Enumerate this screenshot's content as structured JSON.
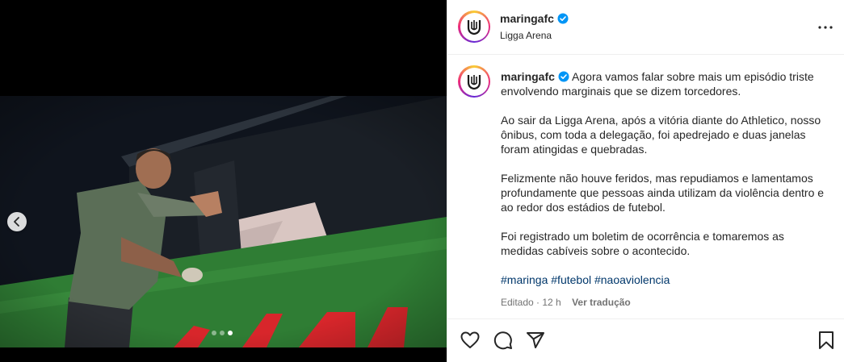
{
  "post": {
    "media_dots": [
      false,
      false,
      true
    ],
    "prev_icon": "chevron-left-icon"
  },
  "header": {
    "username": "maringafc",
    "location": "Ligga Arena",
    "more_icon": "more-horizontal-icon"
  },
  "caption": {
    "username": "maringafc",
    "first_line": "Agora vamos falar sobre mais um episódio triste envolvendo marginais que se dizem torcedores.",
    "paragraphs": [
      "Ao sair da Ligga Arena, após a vitória diante do Athletico, nosso ônibus, com toda a delegação, foi apedrejado e duas janelas foram atingidas e quebradas.",
      "Felizmente não houve feridos, mas repudiamos e lamentamos profundamente que pessoas ainda utilizam da violência dentro e ao redor dos estádios de futebol.",
      "Foi registrado um boletim de ocorrência e tomaremos as medidas cabíveis sobre o acontecido."
    ],
    "hashtags": [
      "#maringa",
      "#futebol",
      "#naoaviolencia"
    ],
    "edited": "Editado · 12 h",
    "translate": "Ver tradução"
  },
  "actions": {
    "like_icon": "heart-icon",
    "comment_icon": "comment-icon",
    "share_icon": "share-icon",
    "save_icon": "bookmark-icon"
  },
  "colors": {
    "verified": "#0095f6",
    "hashtag": "#00376b",
    "bus_green": "#2f7d34",
    "bus_red": "#d8262b"
  }
}
